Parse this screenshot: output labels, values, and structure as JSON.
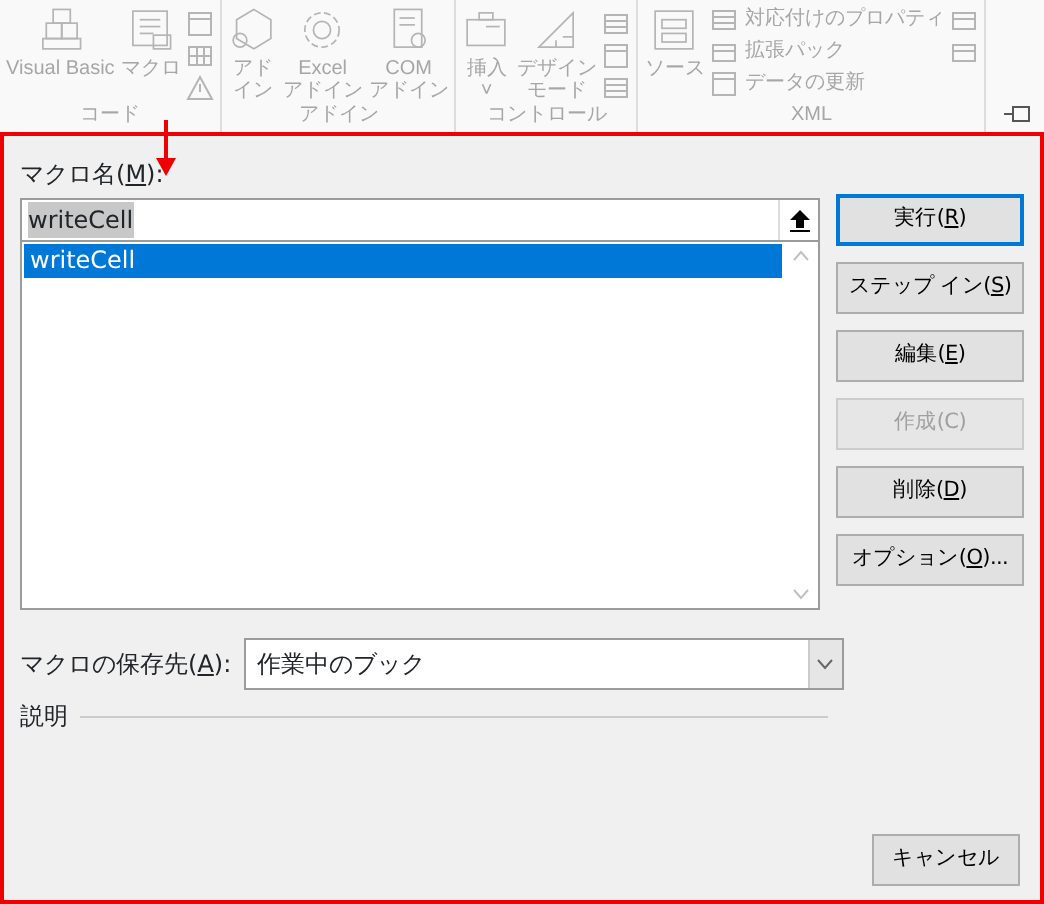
{
  "ribbon": {
    "disabled": true,
    "groups": [
      {
        "label": "コード",
        "items": [
          {
            "lines": [
              "Visual Basic"
            ]
          },
          {
            "lines": [
              "マクロ"
            ]
          }
        ]
      },
      {
        "label": "アドイン",
        "items": [
          {
            "lines": [
              "アド",
              "イン"
            ]
          },
          {
            "lines": [
              "Excel",
              "アドイン"
            ]
          },
          {
            "lines": [
              "COM",
              "アドイン"
            ]
          }
        ]
      },
      {
        "label": "コントロール",
        "items": [
          {
            "lines": [
              "挿入",
              "˅"
            ]
          },
          {
            "lines": [
              "デザイン",
              "モード"
            ]
          }
        ]
      },
      {
        "label": "XML",
        "items": [
          {
            "lines": [
              "ソース"
            ]
          }
        ],
        "small_items": [
          "対応付けのプロパティ",
          "拡張パック",
          "データの更新"
        ]
      }
    ]
  },
  "dialog": {
    "name_label": {
      "pre": "マクロ名(",
      "key": "M",
      "post": "):"
    },
    "name_value": "writeCell",
    "name_value_highlighted": true,
    "macros": [
      {
        "name": "writeCell",
        "selected": true
      }
    ],
    "buttons": [
      {
        "pre": "実行(",
        "key": "R",
        "post": ")",
        "focused": true,
        "disabled": false
      },
      {
        "pre": "ステップ イン(",
        "key": "S",
        "post": ")",
        "focused": false,
        "disabled": false
      },
      {
        "pre": "編集(",
        "key": "E",
        "post": ")",
        "focused": false,
        "disabled": false
      },
      {
        "pre": "作成(C)",
        "focused": false,
        "disabled": true
      },
      {
        "pre": "削除(",
        "key": "D",
        "post": ")",
        "focused": false,
        "disabled": false
      },
      {
        "pre": "オプション(",
        "key": "O",
        "post": ")...",
        "focused": false,
        "disabled": false
      }
    ],
    "store_label": {
      "pre": "マクロの保存先(",
      "key": "A",
      "post": "):"
    },
    "store_value": "作業中のブック",
    "description_label": "説明",
    "cancel": {
      "pre": "キャンセル"
    }
  }
}
